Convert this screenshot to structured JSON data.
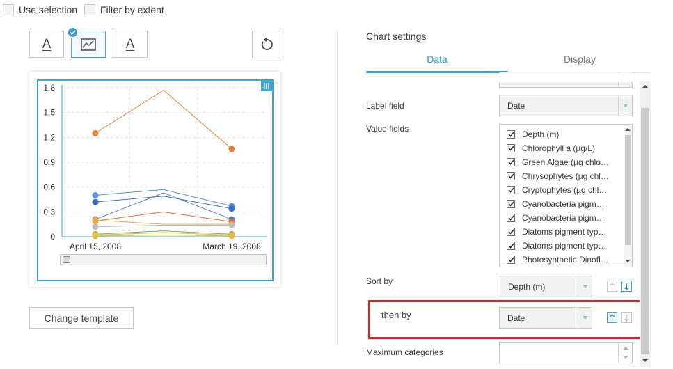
{
  "top_options": {
    "use_selection": "Use selection",
    "filter_by_extent": "Filter by extent"
  },
  "templates": {
    "left_letter": "A",
    "right_letter": "A"
  },
  "buttons": {
    "change_template": "Change template"
  },
  "chart_settings": {
    "title": "Chart settings",
    "tabs": {
      "data": "Data",
      "display": "Display"
    },
    "label_field": {
      "label": "Label field",
      "value": "Date"
    },
    "value_fields": {
      "label": "Value fields",
      "items": [
        "Depth (m)",
        "Chlorophyll a (µg/L)",
        "Green Algae (µg chlo…",
        "Chrysophytes (µg chl…",
        "Cryptophytes (µg chl…",
        "Cyanobacteria pigm…",
        "Cyanobacteria pigm…",
        "Diatoms pigment typ…",
        "Diatoms pigment typ…",
        "Photosynthetic Dinofl…"
      ]
    },
    "sort_by": {
      "label": "Sort by",
      "value": "Depth (m)"
    },
    "then_by": {
      "label": "then by",
      "value": "Date"
    },
    "max_categories": {
      "label": "Maximum categories",
      "value": ""
    }
  },
  "chart_data": {
    "type": "line",
    "categories": [
      "April 15, 2008",
      "",
      "March 19, 2008"
    ],
    "x_tick_labels": [
      "April 15, 2008",
      "March 19, 2008"
    ],
    "ylim": [
      0,
      1.8
    ],
    "y_ticks": [
      "0",
      "0.3",
      "0.6",
      "0.9",
      "1.2",
      "1.5",
      "1.8"
    ],
    "grid": true,
    "series": [
      {
        "values": [
          1.25,
          1.77,
          1.06
        ],
        "color": "#e8803a"
      },
      {
        "values": [
          0.5,
          0.57,
          0.37
        ],
        "color": "#5b8fd6"
      },
      {
        "values": [
          0.42,
          0.49,
          0.34
        ],
        "color": "#3d6fc7"
      },
      {
        "values": [
          0.21,
          0.53,
          0.21
        ],
        "color": "#5a7ac9"
      },
      {
        "values": [
          0.19,
          0.3,
          0.18
        ],
        "color": "#ea6d3a"
      },
      {
        "values": [
          0.2,
          0.15,
          0.15
        ],
        "color": "#f0a840"
      },
      {
        "values": [
          0.12,
          0.14,
          0.14
        ],
        "color": "#bdbdbd"
      },
      {
        "values": [
          0.03,
          0.07,
          0.03
        ],
        "color": "#6ab070"
      },
      {
        "values": [
          0.02,
          0.05,
          0.02
        ],
        "color": "#e0c02a"
      },
      {
        "values": [
          0.01,
          0.02,
          0.01
        ],
        "color": "#f0b83a"
      }
    ]
  }
}
